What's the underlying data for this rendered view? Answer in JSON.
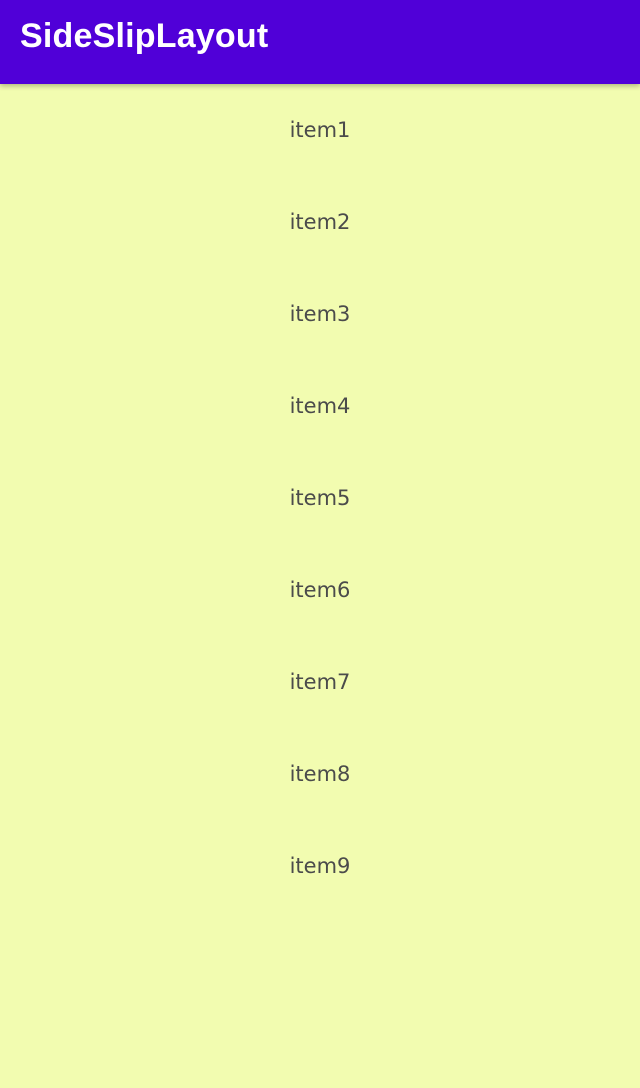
{
  "appbar": {
    "title": "SideSlipLayout",
    "background": "#5000D8",
    "title_color": "#FFFFFF"
  },
  "screen": {
    "background": "#F2FCB0",
    "item_text_color": "#4B4B4B"
  },
  "list": {
    "items": [
      {
        "label": "item1"
      },
      {
        "label": "item2"
      },
      {
        "label": "item3"
      },
      {
        "label": "item4"
      },
      {
        "label": "item5"
      },
      {
        "label": "item6"
      },
      {
        "label": "item7"
      },
      {
        "label": "item8"
      },
      {
        "label": "item9"
      }
    ]
  }
}
